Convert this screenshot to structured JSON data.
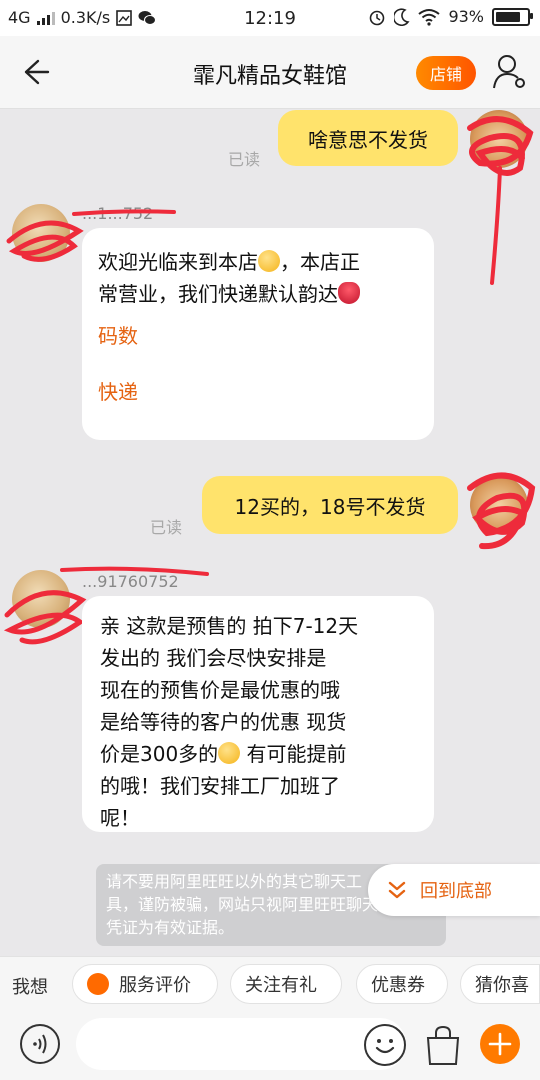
{
  "status_bar": {
    "network": "4G",
    "speed": "0.3K/s",
    "time": "12:19",
    "battery": "93%"
  },
  "header": {
    "back_icon": "arrow-left-icon",
    "title": "霏凡精品女鞋馆",
    "shop_button": "店铺",
    "user_icon": "user-settings-icon"
  },
  "messages": [
    {
      "from": "me",
      "text": "啥意思不发货",
      "read": "已读"
    },
    {
      "from": "shop",
      "name": "...1...752",
      "text_line1_a": "欢迎光临来到本店",
      "text_line1_b": "，本店正",
      "text_line2": "常营业，我们快递默认韵达",
      "link1": "码数",
      "link2": "快递"
    },
    {
      "from": "me",
      "text": "12买的，18号不发货",
      "read": "已读"
    },
    {
      "from": "shop",
      "name": "...91760752",
      "lines": [
        "亲 这款是预售的 拍下7-12天",
        "发出的 我们会尽快安排是",
        "现在的预售价是最优惠的哦",
        "是给等待的客户的优惠 现货"
      ],
      "line5_a": "价是300多的",
      "line5_b": " 有可能提前",
      "line6": "的哦！我们安排工厂加班了",
      "line7": "呢！"
    }
  ],
  "notice": {
    "line1": "请不要用阿里旺旺以外的其它聊天工",
    "line2": "具，谨防被骗，网站只视阿里旺旺聊天",
    "line3": "凭证为有效证据。"
  },
  "scroll_bottom_button": "回到底部",
  "quick_bar": {
    "label": "我想",
    "chips": [
      "服务评价",
      "关注有礼",
      "优惠券",
      "猜你喜"
    ]
  },
  "input_bar": {
    "placeholder": "",
    "icons": [
      "voice-icon",
      "emoji-icon",
      "bag-icon",
      "plus-icon"
    ]
  },
  "colors": {
    "accent": "#ff6a00",
    "my_bubble": "#ffe36c",
    "link": "#e56312",
    "redaction": "#ee2b3b"
  }
}
